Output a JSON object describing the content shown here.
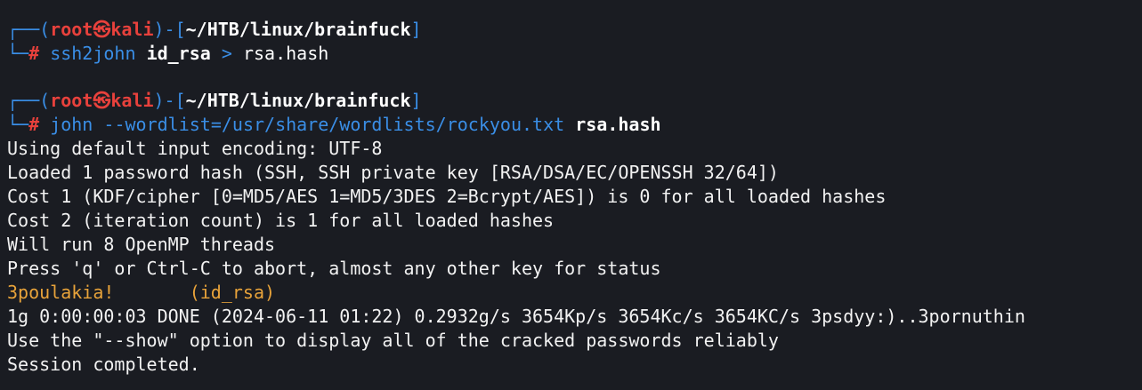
{
  "prompt1": {
    "bracket_open": "┌──(",
    "user": "root",
    "skull": "㉿",
    "host": "kali",
    "path_open": ")-[",
    "path": "~/HTB/linux/brainfuck",
    "path_close": "]",
    "corner": "└─",
    "hash": "#",
    "cmd": "ssh2john",
    "arg1": "id_rsa",
    "redirect": ">",
    "arg2": "rsa.hash"
  },
  "prompt2": {
    "bracket_open": "┌──(",
    "user": "root",
    "skull": "㉿",
    "host": "kali",
    "path_open": ")-[",
    "path": "~/HTB/linux/brainfuck",
    "path_close": "]",
    "corner": "└─",
    "hash": "#",
    "cmd": "john",
    "flag": "--wordlist=/usr/share/wordlists/rockyou.txt",
    "arg": "rsa.hash"
  },
  "output": [
    "Using default input encoding: UTF-8",
    "Loaded 1 password hash (SSH, SSH private key [RSA/DSA/EC/OPENSSH 32/64])",
    "Cost 1 (KDF/cipher [0=MD5/AES 1=MD5/3DES 2=Bcrypt/AES]) is 0 for all loaded hashes",
    "Cost 2 (iteration count) is 1 for all loaded hashes",
    "Will run 8 OpenMP threads",
    "Press 'q' or Ctrl-C to abort, almost any other key for status"
  ],
  "cracked": {
    "password": "3poulakia!",
    "spacer": "       ",
    "file": "(id_rsa)"
  },
  "tail": [
    "1g 0:00:00:03 DONE (2024-06-11 01:22) 0.2932g/s 3654Kp/s 3654Kc/s 3654KC/s 3psdyy:)..3pornuthin",
    "Use the \"--show\" option to display all of the cracked passwords reliably",
    "Session completed."
  ],
  "colors": {
    "background": "#1a1c22",
    "prompt_blue": "#3a8ee6",
    "prompt_red": "#e8413c",
    "password_orange": "#e8a33a",
    "text": "#f2f2f2"
  }
}
